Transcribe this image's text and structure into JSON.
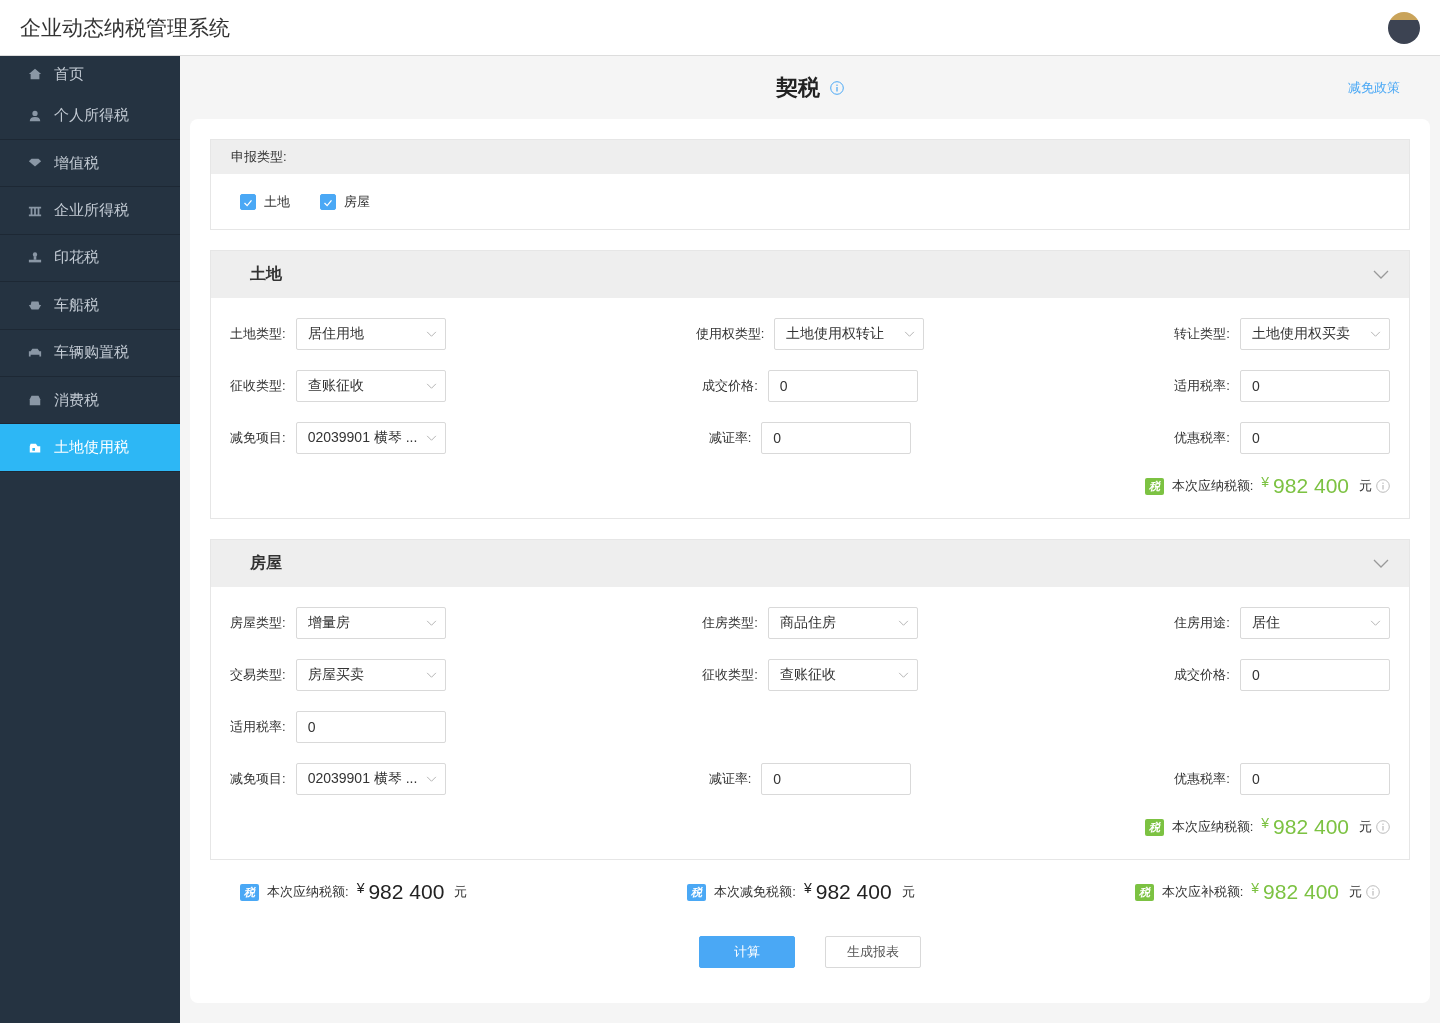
{
  "app_title": "企业动态纳税管理系统",
  "sidebar": {
    "items": [
      {
        "label": "首页",
        "selected": false
      },
      {
        "label": "个人所得税",
        "selected": false
      },
      {
        "label": "增值税",
        "selected": false
      },
      {
        "label": "企业所得税",
        "selected": false
      },
      {
        "label": "印花税",
        "selected": false
      },
      {
        "label": "车船税",
        "selected": false
      },
      {
        "label": "车辆购置税",
        "selected": false
      },
      {
        "label": "消费税",
        "selected": false
      },
      {
        "label": "土地使用税",
        "selected": true
      }
    ]
  },
  "page": {
    "title": "契税",
    "link": "减免政策"
  },
  "declare": {
    "label": "申报类型:",
    "options": [
      {
        "label": "土地",
        "checked": true
      },
      {
        "label": "房屋",
        "checked": true
      }
    ]
  },
  "sections": [
    {
      "title": "土地",
      "expanded": true,
      "rows": [
        [
          {
            "label": "土地类型:",
            "value": "居住用地",
            "kind": "select"
          },
          {
            "label": "使用权类型:",
            "value": "土地使用权转让",
            "kind": "select"
          },
          {
            "label": "转让类型:",
            "value": "土地使用权买卖",
            "kind": "select"
          }
        ],
        [
          {
            "label": "征收类型:",
            "value": "查账征收",
            "kind": "select"
          },
          {
            "label": "成交价格:",
            "value": "0",
            "kind": "input"
          },
          {
            "label": "适用税率:",
            "value": "0",
            "kind": "input"
          }
        ],
        [
          {
            "label": "减免项目:",
            "value": "02039901 横琴 ...",
            "kind": "select"
          },
          {
            "label": "减证率:",
            "value": "0",
            "kind": "input"
          },
          {
            "label": "优惠税率:",
            "value": "0",
            "kind": "input"
          }
        ]
      ],
      "total": {
        "badge": "税",
        "label": "本次应纳税额:",
        "currency": "¥",
        "amount": "982 400",
        "unit": "元",
        "kind": "highlight"
      }
    },
    {
      "title": "房屋",
      "expanded": true,
      "rows": [
        [
          {
            "label": "房屋类型:",
            "value": "增量房",
            "kind": "select"
          },
          {
            "label": "住房类型:",
            "value": "商品住房",
            "kind": "select"
          },
          {
            "label": "住房用途:",
            "value": "居住",
            "kind": "select"
          }
        ],
        [
          {
            "label": "交易类型:",
            "value": "房屋买卖",
            "kind": "select"
          },
          {
            "label": "征收类型:",
            "value": "查账征收",
            "kind": "select"
          },
          {
            "label": "成交价格:",
            "value": "0",
            "kind": "input"
          }
        ],
        [
          {
            "label": "适用税率:",
            "value": "0",
            "kind": "input"
          }
        ],
        [
          {
            "label": "减免项目:",
            "value": "02039901 横琴 ...",
            "kind": "select"
          },
          {
            "label": "减证率:",
            "value": "0",
            "kind": "input"
          },
          {
            "label": "优惠税率:",
            "value": "0",
            "kind": "input"
          }
        ]
      ],
      "total": {
        "badge": "税",
        "label": "本次应纳税额:",
        "currency": "¥",
        "amount": "982 400",
        "unit": "元",
        "kind": "highlight"
      }
    }
  ],
  "totals": [
    {
      "badge": "税",
      "label": "本次应纳税额:",
      "currency": "¥",
      "amount": "982 400",
      "unit": "元",
      "kind": "plain"
    },
    {
      "badge": "税",
      "label": "本次减免税额:",
      "currency": "¥",
      "amount": "982 400",
      "unit": "元",
      "kind": "plain"
    },
    {
      "badge": "税",
      "label": "本次应补税额:",
      "currency": "¥",
      "amount": "982 400",
      "unit": "元",
      "kind": "highlight"
    }
  ],
  "buttons": [
    {
      "label": "计算",
      "kind": "primary"
    },
    {
      "label": "生成报表",
      "kind": "default"
    }
  ]
}
